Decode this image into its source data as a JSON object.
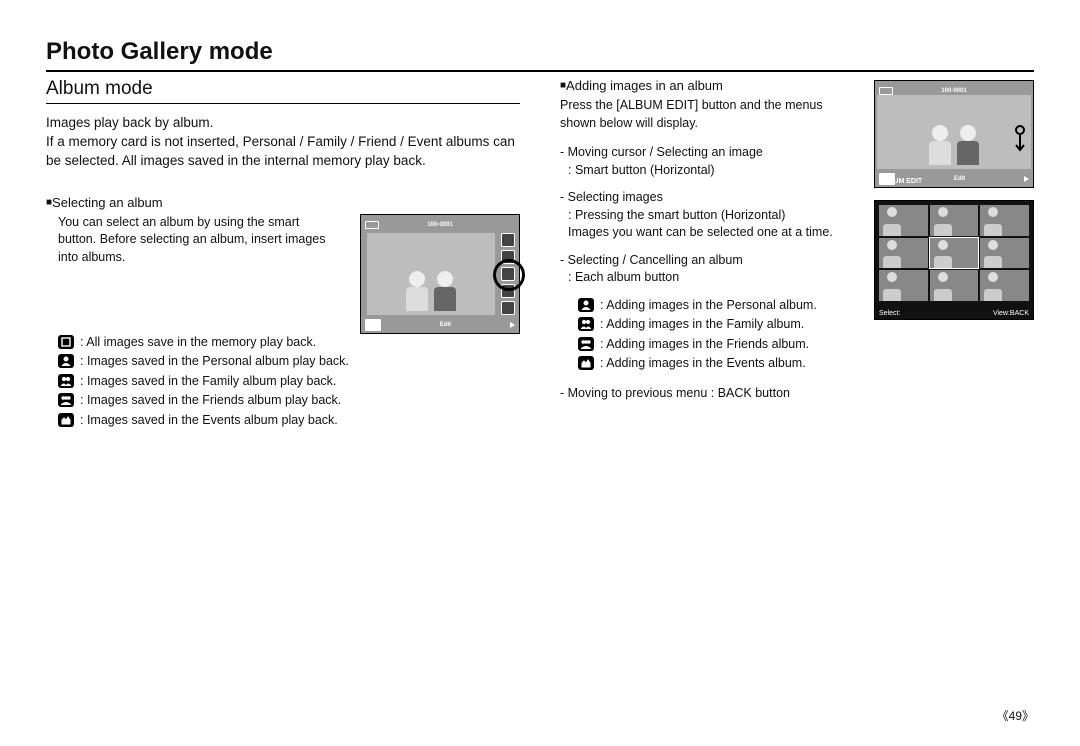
{
  "title": "Photo Gallery mode",
  "left": {
    "section": "Album mode",
    "intro1": "Images play back by album.",
    "intro2": "If a memory card is not inserted, Personal / Family / Friend / Event albums can be selected. All images saved in the internal memory play back.",
    "bullet": "Selecting an album",
    "desc": "You can select an album by using the smart button. Before selecting an album, insert images into albums.",
    "icons": [
      ": All images save in the memory play back.",
      ": Images saved in the Personal album play back.",
      ": Images saved in the Family album play back.",
      ": Images saved in the Friends album play back.",
      ": Images saved in the Events album play back."
    ],
    "osd": {
      "file": "100-0001",
      "edit": "Edit"
    }
  },
  "right": {
    "bullet": "Adding images in an album",
    "intro": "Press the [ALBUM EDIT] button and the menus shown below will display.",
    "d1a": "- Moving cursor / Selecting an image",
    "d1b": ": Smart button (Horizontal)",
    "d2a": "- Selecting images",
    "d2b": ": Pressing the smart button (Horizontal)",
    "d2c": "Images you want can be selected one at a time.",
    "d3a": "- Selecting / Cancelling an album",
    "d3b": ": Each album button",
    "icons": [
      ": Adding images in the Personal album.",
      ": Adding images in the Family album.",
      ": Adding images in the Friends album.",
      ": Adding images in the Events album."
    ],
    "d4": "- Moving to previous menu : BACK button",
    "osdB": {
      "file": "100-0001",
      "alb": "ALBUM EDIT",
      "edit": "Edit"
    },
    "osdC": {
      "select": "Select:",
      "back": "View:BACK"
    }
  },
  "pagenum": "《49》"
}
